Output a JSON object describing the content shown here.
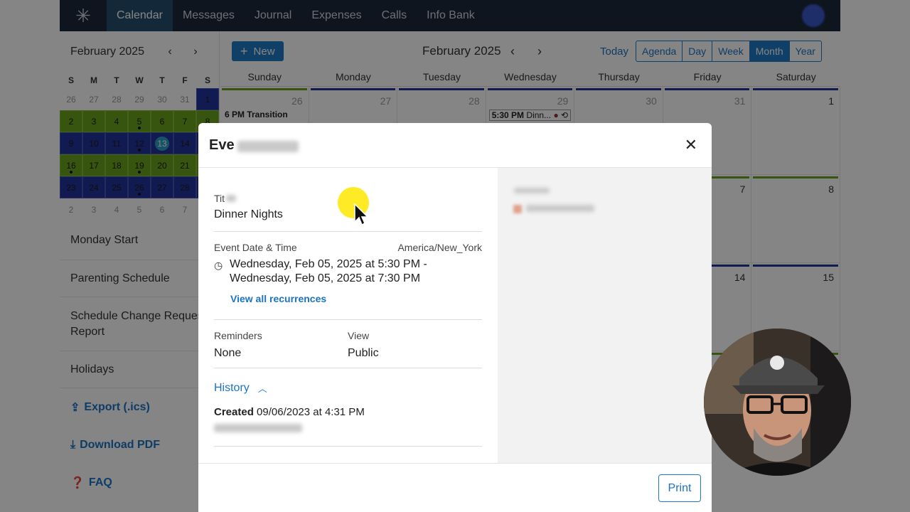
{
  "topnav": {
    "items": [
      "Calendar",
      "Messages",
      "Journal",
      "Expenses",
      "Calls",
      "Info Bank"
    ]
  },
  "sidebar": {
    "month_title": "February 2025",
    "dow": [
      "S",
      "M",
      "T",
      "W",
      "T",
      "F",
      "S"
    ],
    "weeks": [
      [
        "26",
        "27",
        "28",
        "29",
        "30",
        "31",
        "1"
      ],
      [
        "2",
        "3",
        "4",
        "5",
        "6",
        "7",
        "8"
      ],
      [
        "9",
        "10",
        "11",
        "12",
        "13",
        "14",
        "15"
      ],
      [
        "16",
        "17",
        "18",
        "19",
        "20",
        "21",
        "22"
      ],
      [
        "23",
        "24",
        "25",
        "26",
        "27",
        "28",
        "1"
      ],
      [
        "2",
        "3",
        "4",
        "5",
        "6",
        "7",
        "8"
      ]
    ],
    "links": [
      "Monday Start",
      "Parenting Schedule",
      "Schedule Change Request Report",
      "Holidays"
    ],
    "actions": [
      "Export (.ics)",
      "Download PDF",
      "FAQ"
    ]
  },
  "calendar": {
    "new_label": "New",
    "title": "February 2025",
    "today_label": "Today",
    "views": [
      "Agenda",
      "Day",
      "Week",
      "Month",
      "Year"
    ],
    "active_view": "Month",
    "dow": [
      "Sunday",
      "Monday",
      "Tuesday",
      "Wednesday",
      "Thursday",
      "Friday",
      "Saturday"
    ],
    "week1": [
      "26",
      "27",
      "28",
      "29",
      "30",
      "31",
      "1"
    ],
    "week2_visible": [
      "7",
      "8"
    ],
    "week3_visible": [
      "14",
      "15"
    ],
    "event_sunday": "6 PM Transition",
    "event_wednesday_time": "5:30 PM",
    "event_wednesday_title": "Dinn...",
    "colors": {
      "green": "#6aa31b",
      "blue": "#24349c",
      "accent": "#1f7cc6"
    }
  },
  "modal": {
    "title_visible": "Eve",
    "title_label_visible": "Tit",
    "title_value": "Dinner Nights",
    "date_label": "Event Date & Time",
    "timezone": "America/New_York",
    "start": "Wednesday, Feb 05, 2025 at 5:30 PM -",
    "end": "Wednesday, Feb 05, 2025 at 7:30 PM",
    "recurrences_link": "View all recurrences",
    "reminders_label": "Reminders",
    "reminders_value": "None",
    "view_label": "View",
    "view_value": "Public",
    "history_label": "History",
    "created_label": "Created",
    "created_value": "09/06/2023 at 4:31 PM",
    "print_label": "Print"
  }
}
